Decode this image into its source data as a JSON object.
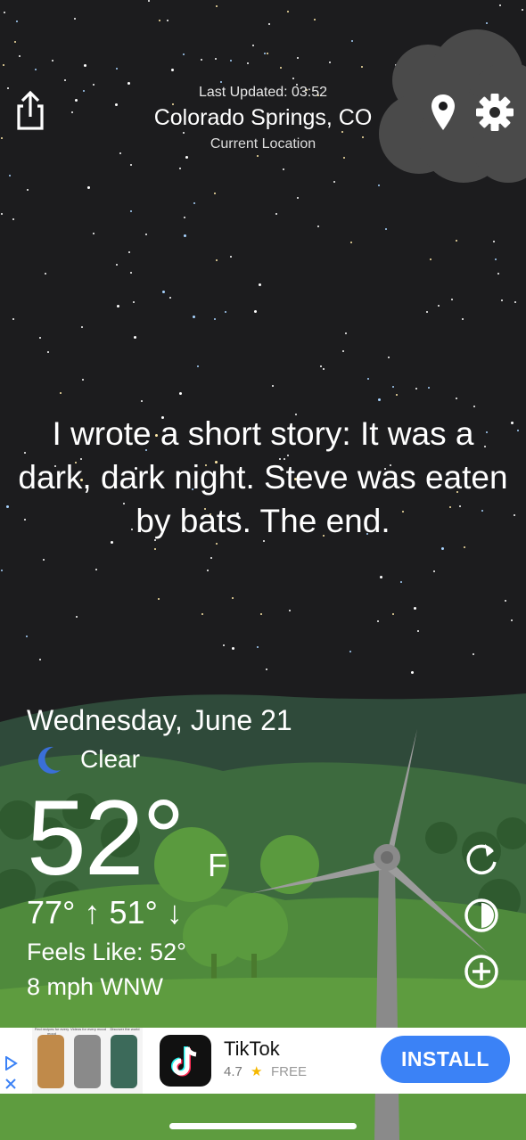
{
  "header": {
    "last_updated": "Last Updated: 03:52",
    "location": "Colorado Springs, CO",
    "location_sub": "Current Location"
  },
  "message": "I wrote a short story: It was a dark, dark night. Steve was eaten by bats. The end.",
  "weather": {
    "date": "Wednesday, June 21",
    "condition": "Clear",
    "temperature": "52°",
    "unit": "F",
    "high_low": "77° ↑  51° ↓",
    "feels_like": "Feels Like: 52°",
    "wind": "8 mph WNW"
  },
  "ad": {
    "app_name": "TikTok",
    "rating": "4.7",
    "price": "FREE",
    "install_label": "INSTALL",
    "screenshot_captions": [
      "Find recipes for every mood",
      "Videos for every mood",
      "Discover the world"
    ]
  },
  "icons": {
    "share": "share-icon",
    "location": "location-pin-icon",
    "settings": "gear-icon",
    "refresh": "refresh-icon",
    "theme": "theme-icon",
    "add": "add-circle-icon",
    "condition": "moon-icon"
  },
  "colors": {
    "sky": "#1c1c1e",
    "hills": "#4a8a3a",
    "install_button": "#3b82f6",
    "moon": "#3a6fd8"
  }
}
